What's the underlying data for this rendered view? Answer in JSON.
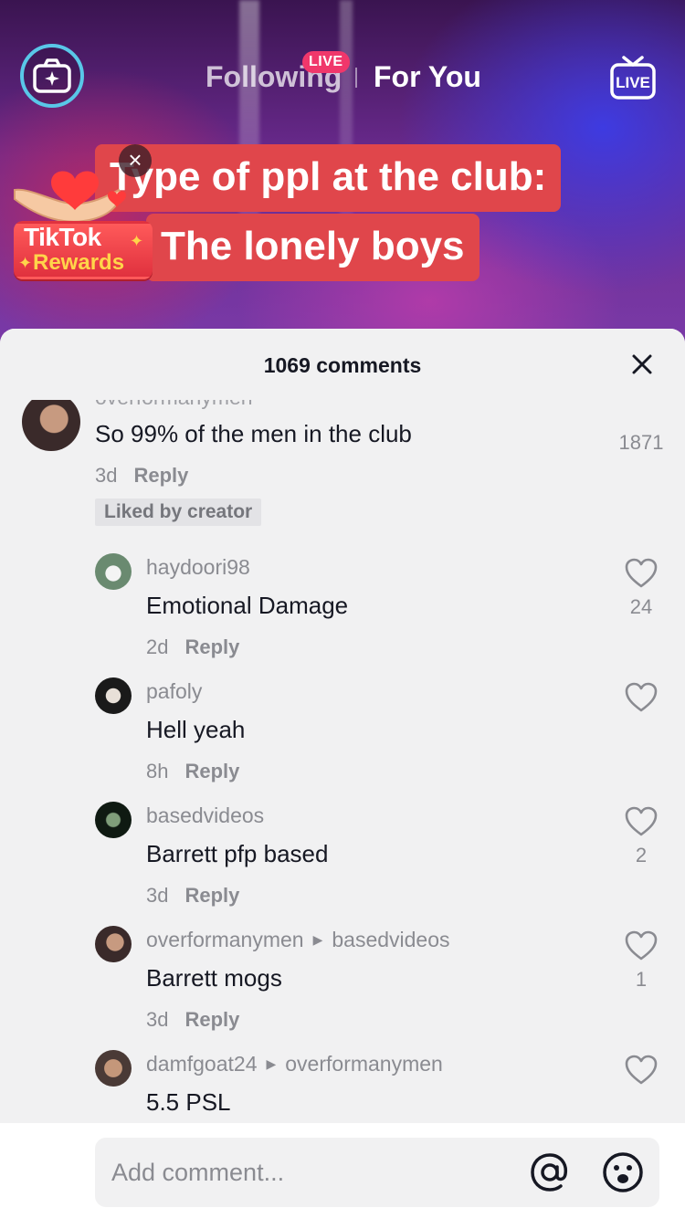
{
  "top": {
    "tab_following": "Following",
    "live_badge": "LIVE",
    "tab_for_you": "For You",
    "live_button": "LIVE"
  },
  "video": {
    "caption_line1": "Type of ppl at the club:",
    "caption_line2": "The lonely boys",
    "rewards_line1": "TikTok",
    "rewards_line2": "Rewards"
  },
  "sheet": {
    "title": "1069 comments",
    "comments": [
      {
        "user": "overformanymen",
        "text": "So 99% of the men in the club",
        "time": "3d",
        "reply": "Reply",
        "likes": "1871",
        "badge": "Liked by creator"
      },
      {
        "user": "haydoori98",
        "text": "Emotional Damage",
        "time": "2d",
        "reply": "Reply",
        "likes": "24"
      },
      {
        "user": "pafoly",
        "text": "Hell yeah",
        "time": "8h",
        "reply": "Reply",
        "likes": ""
      },
      {
        "user": "basedvideos",
        "text": "Barrett pfp based",
        "time": "3d",
        "reply": "Reply",
        "likes": "2"
      },
      {
        "user": "overformanymen",
        "reply_to": "basedvideos",
        "text": "Barrett mogs",
        "time": "3d",
        "reply": "Reply",
        "likes": "1"
      },
      {
        "user": "damfgoat24",
        "reply_to": "overformanymen",
        "text": "5.5 PSL",
        "likes": ""
      }
    ]
  },
  "input": {
    "placeholder": "Add comment..."
  },
  "colors": {
    "accent_live": "#f0376b",
    "caption_bg": "#e0464b",
    "sheet_bg": "#f1f1f2",
    "camera_ring": "#59c7e8"
  }
}
